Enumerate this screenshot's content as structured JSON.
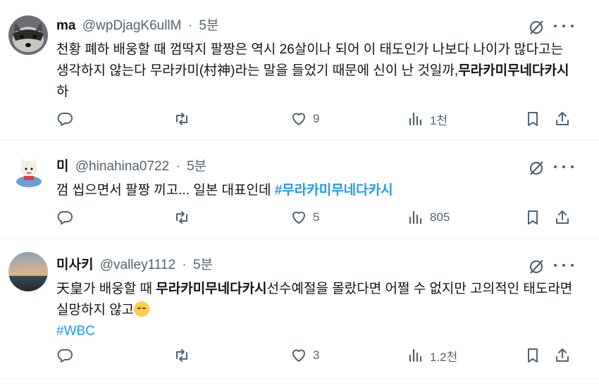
{
  "tweets": [
    {
      "name": "ma",
      "handle": "@wpDjagK6ullM",
      "time": "5분",
      "text_1": "천황 폐하 배웅할 때 껌딱지 팔짱은 역시 26살이나 되어 이 태도인가 나보다 나이가 많다고는 생각하지 않는다 무라카미(村神)라는 말을 들었기 때문에 신이 난 것일까,",
      "text_bold": "무라카미무네다카시",
      "text_2": "하",
      "replies": "",
      "retweets": "",
      "likes": "9",
      "views": "1천"
    },
    {
      "name": "미",
      "handle": "@hinahina0722",
      "time": "5분",
      "text_1": "껌 씹으면서 팔짱 끼고... 일본 대표인데 ",
      "hashtag": "#무라카미무네다카시",
      "likes": "5",
      "views": "805"
    },
    {
      "name": "미사키",
      "handle": "@valley1112",
      "time": "5분",
      "text_1": "天皇가 배웅할 때 ",
      "text_bold": "무라카미무네다카시",
      "text_2": "선수예절을 몰랐다면 어쩔 수 없지만 고의적인 태도라면 실망하지 않고",
      "hashtag": "#WBC",
      "likes": "3",
      "views": "1.2천"
    }
  ],
  "icons": {
    "reply": "reply-icon",
    "retweet": "retweet-icon",
    "like": "heart-icon",
    "views": "views-icon",
    "bookmark": "bookmark-icon",
    "share": "share-icon",
    "grok": "grok-icon",
    "more": "more-icon"
  },
  "colors": {
    "link": "#1d9bf0",
    "secondary": "#536471",
    "text": "#0f1419"
  }
}
